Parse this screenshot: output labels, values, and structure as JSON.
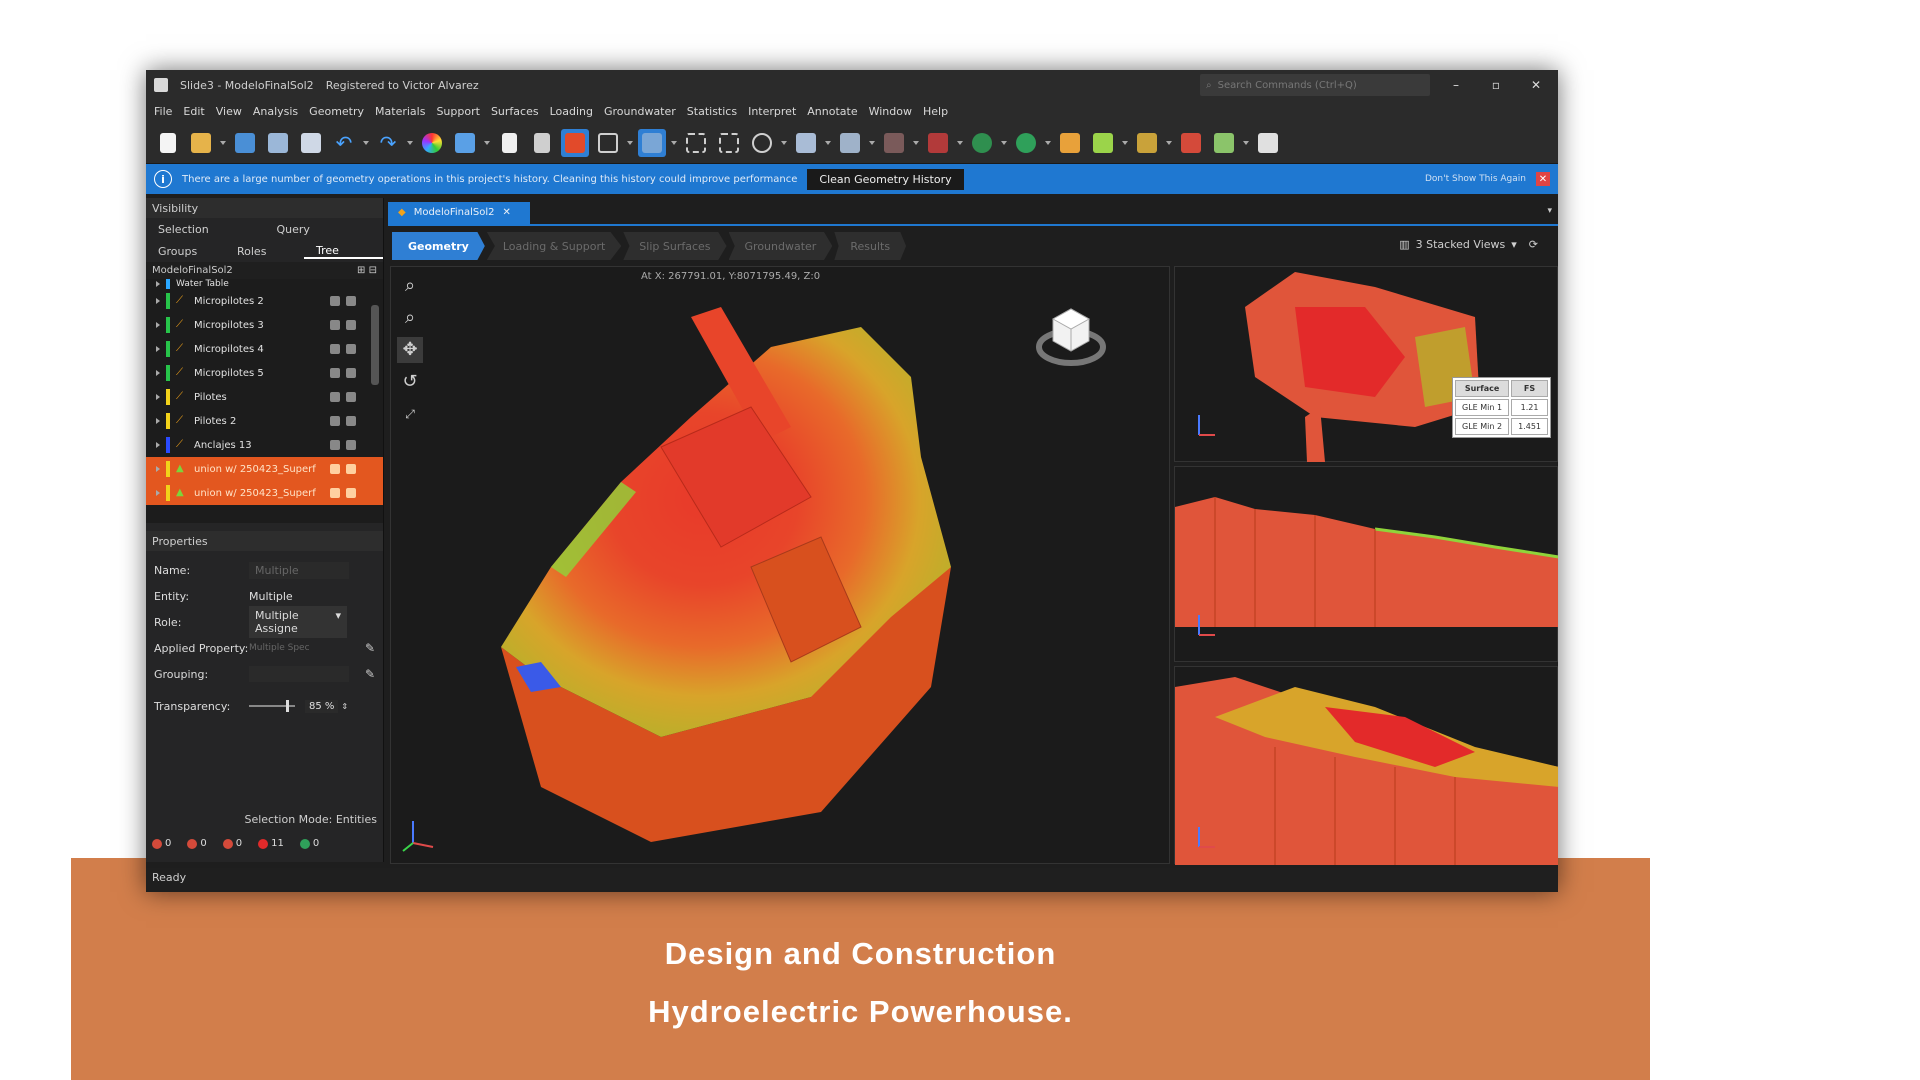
{
  "window": {
    "title": "Slide3 - ModeloFinalSol2",
    "registration": "Registered to Victor Alvarez",
    "search_placeholder": "Search Commands (Ctrl+Q)",
    "controls": [
      "–",
      "▫",
      "✕"
    ]
  },
  "menu": [
    "File",
    "Edit",
    "View",
    "Analysis",
    "Geometry",
    "Materials",
    "Support",
    "Surfaces",
    "Loading",
    "Groundwater",
    "Statistics",
    "Interpret",
    "Annotate",
    "Window",
    "Help"
  ],
  "infobar": {
    "message": "There are a large number of geometry operations in this project's history. Cleaning this history could improve performance",
    "button": "Clean Geometry History",
    "dismiss": "Don't Show This Again"
  },
  "visibility": {
    "header": "Visibility",
    "tabs1": [
      "Selection",
      "Query"
    ],
    "tabs2": [
      "Groups",
      "Roles",
      "Tree"
    ],
    "tree_title": "ModeloFinalSol2",
    "items": [
      {
        "label": "Water Table",
        "color": "#2aa7ff"
      },
      {
        "label": "Micropilotes 2",
        "color": "#27c44a"
      },
      {
        "label": "Micropilotes 3",
        "color": "#27c44a"
      },
      {
        "label": "Micropilotes 4",
        "color": "#27c44a"
      },
      {
        "label": "Micropilotes 5",
        "color": "#27c44a"
      },
      {
        "label": "Pilotes",
        "color": "#f2d21a"
      },
      {
        "label": "Pilotes 2",
        "color": "#f2d21a"
      },
      {
        "label": "Anclajes 13",
        "color": "#2a4bff"
      },
      {
        "label": "union w/ 250423_Superf",
        "color": "#f2d21a"
      },
      {
        "label": "union w/ 250423_Superf",
        "color": "#f2d21a"
      }
    ]
  },
  "properties": {
    "header": "Properties",
    "name_label": "Name:",
    "name_value": "Multiple",
    "entity_label": "Entity:",
    "entity_value": "Multiple",
    "role_label": "Role:",
    "role_value": "Multiple Assigne",
    "applied_label": "Applied Property:",
    "applied_value": "Multiple Spec",
    "grouping_label": "Grouping:",
    "transparency_label": "Transparency:",
    "transparency_value": "85 %",
    "transparency_level": 0.85
  },
  "selection_mode": "Selection Mode: Entities",
  "counts": [
    "0",
    "0",
    "0",
    "11",
    "0"
  ],
  "doc_tab": "ModeloFinalSol2",
  "workflow": [
    "Geometry",
    "Loading & Support",
    "Slip Surfaces",
    "Groundwater",
    "Results"
  ],
  "views_label": "3 Stacked Views",
  "coords": "At X: 267791.01, Y:8071795.49, Z:0",
  "fs_table": {
    "headers": [
      "Surface",
      "FS"
    ],
    "rows": [
      [
        "GLE Min 1",
        "1.21"
      ],
      [
        "GLE Min 2",
        "1.451"
      ]
    ]
  },
  "status": "Ready",
  "caption": {
    "line1": "Design and Construction",
    "line2": "Hydroelectric Powerhouse."
  },
  "colors": {
    "band": "#d27e4b",
    "accent": "#1f78d1",
    "model_orange": "#e3571f"
  }
}
